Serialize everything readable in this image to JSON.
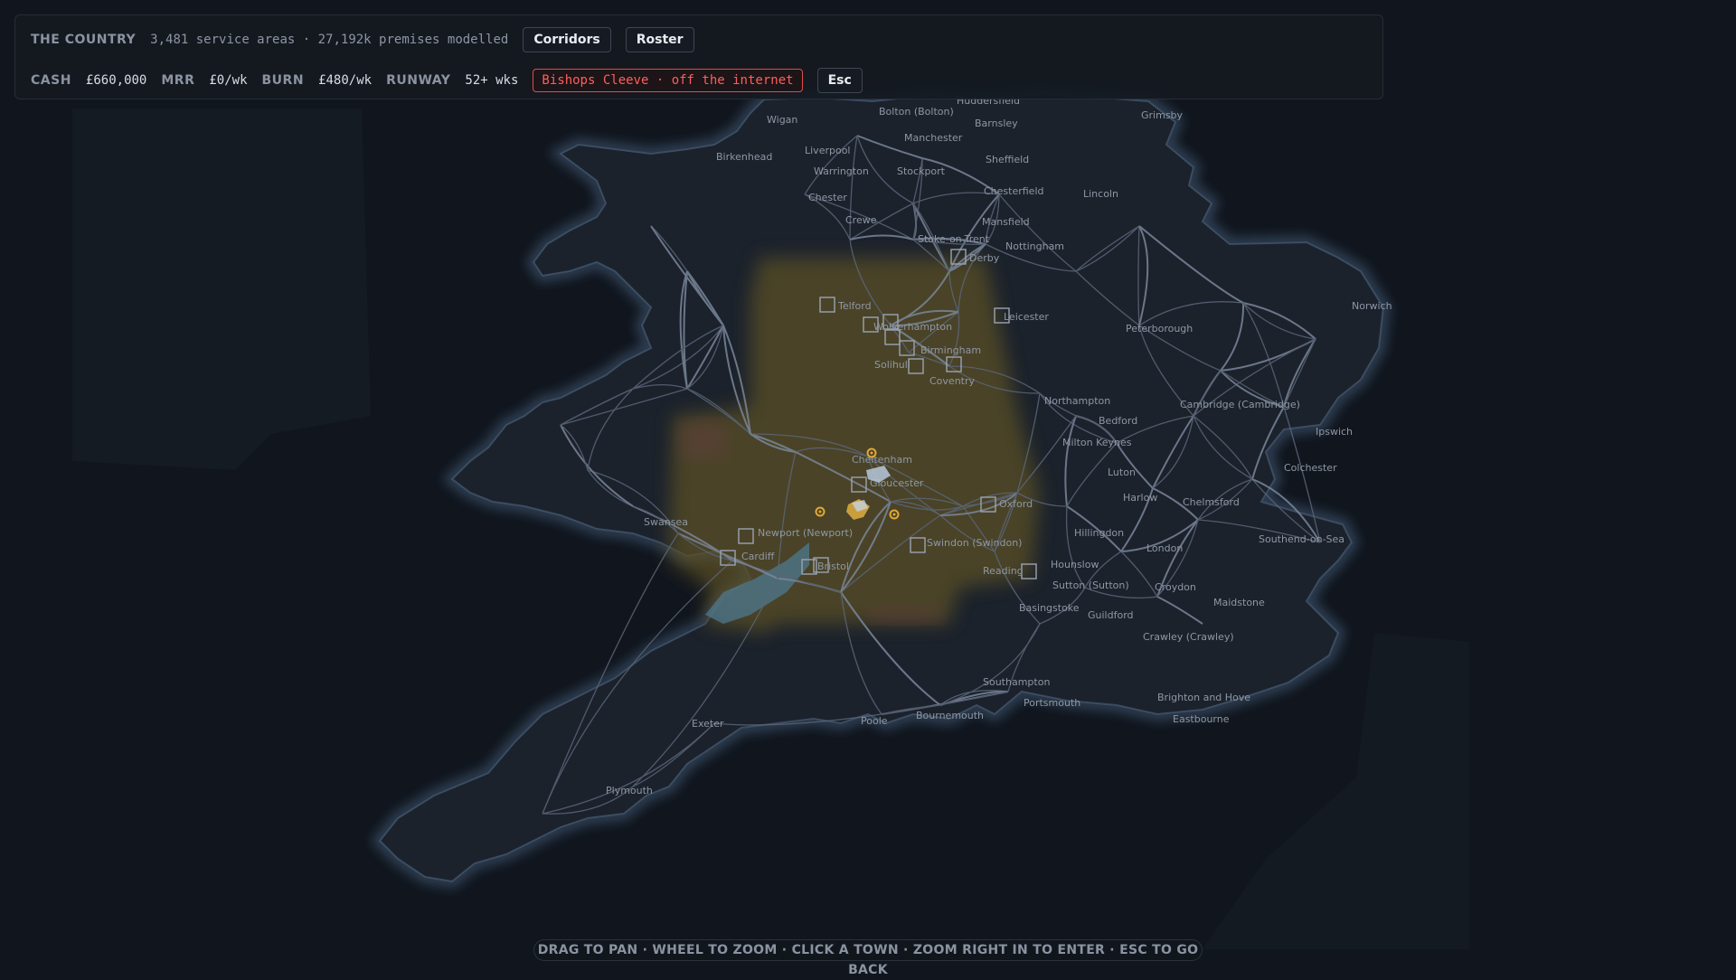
{
  "header": {
    "title": "THE COUNTRY",
    "summary": "3,481 service areas · 27,192k premises modelled",
    "corridors_label": "Corridors",
    "roster_label": "Roster"
  },
  "stats": {
    "cash_label": "CASH",
    "cash_value": "£660,000",
    "mrr_label": "MRR",
    "mrr_value": "£0/wk",
    "burn_label": "BURN",
    "burn_value": "£480/wk",
    "runway_label": "RUNWAY",
    "runway_value": "52+ wks",
    "alert": "Bishops Cleeve · off the internet",
    "esc_label": "Esc"
  },
  "hint": "DRAG TO PAN · WHEEL TO ZOOM · CLICK A TOWN · ZOOM RIGHT IN TO ENTER · ESC TO GO BACK",
  "map": {
    "colors": {
      "background": "#11161e",
      "land": "#1b222c",
      "coast_glow": "#2c3a4c",
      "roads": "#5b6678",
      "coverage": "#6e5d2a",
      "marker": "#e3a835",
      "site_box": "#9aa4b3"
    },
    "towns": [
      "Huddersfield",
      "Grimsby",
      "Bolton (Bolton)",
      "Wigan",
      "Barnsley",
      "Manchester",
      "Liverpool",
      "Birkenhead",
      "Sheffield",
      "Warrington",
      "Stockport",
      "Chesterfield",
      "Lincoln",
      "Chester",
      "Mansfield",
      "Crewe",
      "Stoke-on-Trent",
      "Nottingham",
      "Derby",
      "Telford",
      "Norwich",
      "Leicester",
      "Wolverhampton",
      "Peterborough",
      "Birmingham",
      "Solihull",
      "Coventry",
      "Northampton",
      "Cambridge (Cambridge)",
      "Bedford",
      "Ipswich",
      "Milton Keynes",
      "Cheltenham",
      "Colchester",
      "Luton",
      "Gloucester",
      "Harlow",
      "Chelmsford",
      "Swansea",
      "Oxford",
      "Newport (Newport)",
      "Hillingdon",
      "Southend-on-Sea",
      "London",
      "Swindon (Swindon)",
      "Cardiff",
      "Bristol",
      "Hounslow",
      "Reading",
      "Sutton (Sutton)",
      "Croydon",
      "Maidstone",
      "Basingstoke",
      "Guildford",
      "Crawley (Crawley)",
      "Southampton",
      "Portsmouth",
      "Brighton and Hove",
      "Bournemouth",
      "Poole",
      "Eastbourne",
      "Exeter",
      "Plymouth"
    ]
  }
}
